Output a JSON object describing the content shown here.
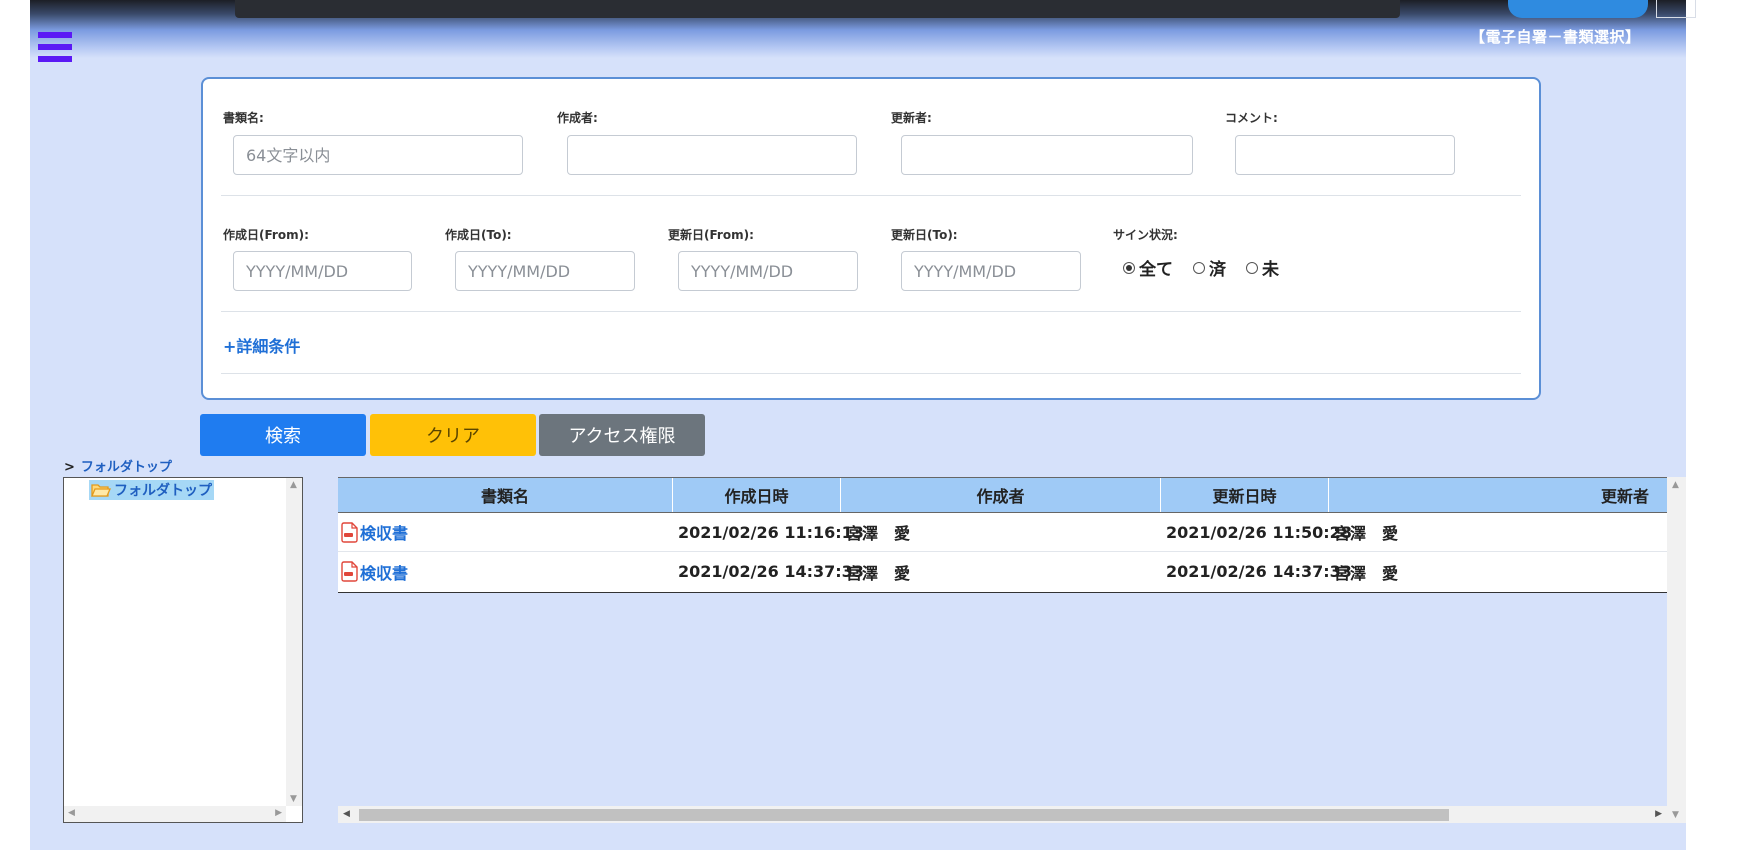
{
  "header": {
    "title": "【電子自署－書類選択】"
  },
  "search": {
    "doc_name": {
      "label": "書類名:",
      "placeholder": "64文字以内",
      "value": ""
    },
    "creator": {
      "label": "作成者:",
      "value": ""
    },
    "updater": {
      "label": "更新者:",
      "value": ""
    },
    "comment": {
      "label": "コメント:",
      "value": ""
    },
    "created_from": {
      "label": "作成日(From):",
      "placeholder": "YYYY/MM/DD"
    },
    "created_to": {
      "label": "作成日(To):",
      "placeholder": "YYYY/MM/DD"
    },
    "updated_from": {
      "label": "更新日(From):",
      "placeholder": "YYYY/MM/DD"
    },
    "updated_to": {
      "label": "更新日(To):",
      "placeholder": "YYYY/MM/DD"
    },
    "sign_status": {
      "label": "サイン状況:",
      "options": [
        "全て",
        "済",
        "未"
      ],
      "selected": "全て"
    },
    "detail_link": "+詳細条件"
  },
  "buttons": {
    "search": "検索",
    "clear": "クリア",
    "access": "アクセス権限"
  },
  "breadcrumb": {
    "separator": ">",
    "current": "フォルダトップ"
  },
  "tree": {
    "root_label": "フォルダトップ"
  },
  "grid": {
    "columns": [
      "書類名",
      "作成日時",
      "作成者",
      "更新日時",
      "更新者"
    ],
    "rows": [
      {
        "name": "検収書",
        "created": "2021/02/26 11:16:13",
        "creator": "宮澤　愛",
        "updated": "2021/02/26 11:50:28",
        "updater": "宮澤　愛"
      },
      {
        "name": "検収書",
        "created": "2021/02/26 14:37:33",
        "creator": "宮澤　愛",
        "updated": "2021/02/26 14:37:33",
        "updater": "宮澤　愛"
      }
    ]
  },
  "colors": {
    "accent": "#1f7cf0",
    "warning": "#ffc107",
    "secondary": "#6c757d",
    "link": "#1f6fd6",
    "background": "#d6e1fa",
    "header_row": "#9fcaf6"
  },
  "icons": {
    "menu": "hamburger-menu-icon",
    "folder": "folder-open-icon",
    "pdf": "pdf-file-icon"
  }
}
